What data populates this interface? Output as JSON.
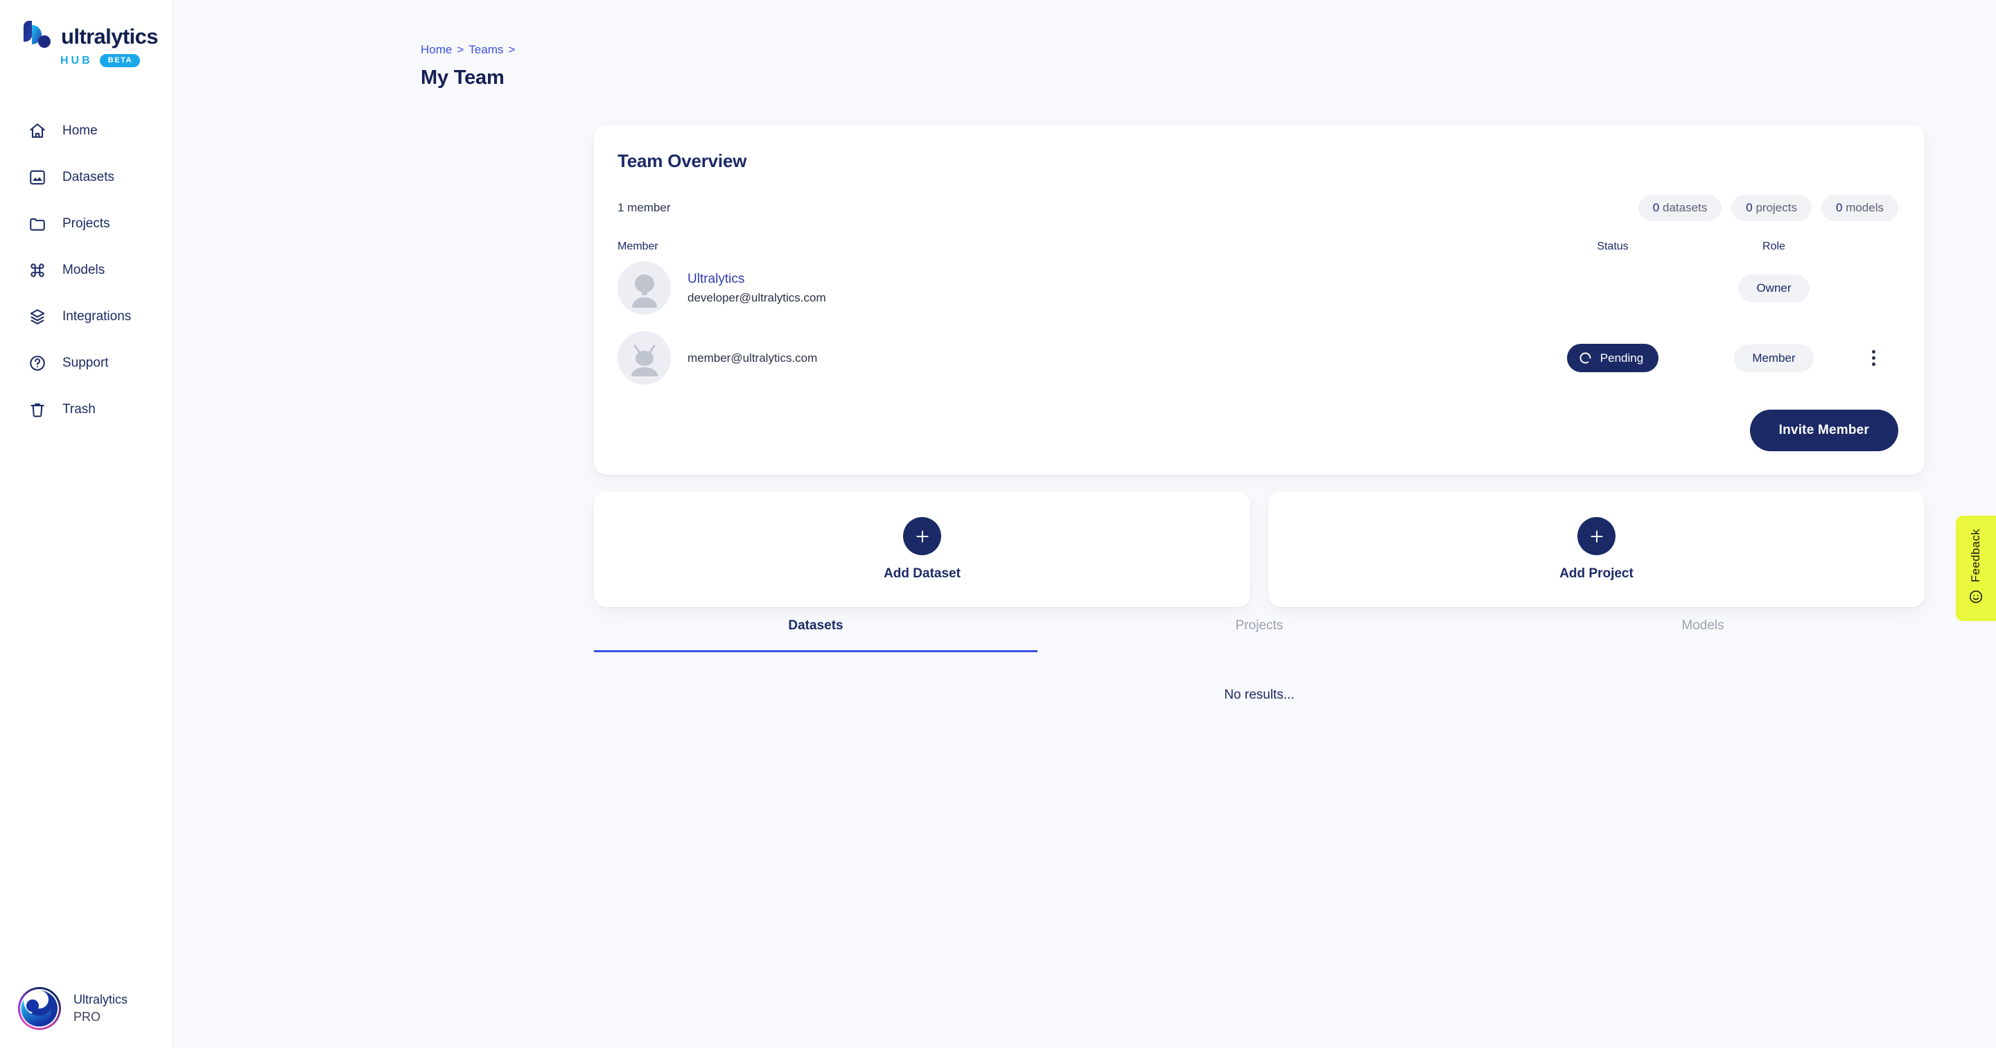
{
  "brand": {
    "word": "ultralytics",
    "hub": "HUB",
    "beta": "BETA"
  },
  "sidebar": {
    "items": [
      {
        "label": "Home",
        "icon": "home-icon"
      },
      {
        "label": "Datasets",
        "icon": "image-icon"
      },
      {
        "label": "Projects",
        "icon": "folder-icon"
      },
      {
        "label": "Models",
        "icon": "command-icon"
      },
      {
        "label": "Integrations",
        "icon": "layers-icon"
      },
      {
        "label": "Support",
        "icon": "question-circle-icon"
      },
      {
        "label": "Trash",
        "icon": "trash-icon"
      }
    ],
    "profile": {
      "name": "Ultralytics",
      "plan": "PRO"
    }
  },
  "breadcrumb": {
    "home": "Home",
    "sep1": ">",
    "teams": "Teams",
    "sep2": ">"
  },
  "page": {
    "title": "My Team"
  },
  "team_overview": {
    "title": "Team Overview",
    "member_count": "1 member",
    "chips": [
      {
        "value": "0",
        "label": "datasets"
      },
      {
        "value": "0",
        "label": "projects"
      },
      {
        "value": "0",
        "label": "models"
      }
    ],
    "columns": {
      "member": "Member",
      "status": "Status",
      "role": "Role"
    },
    "members": [
      {
        "name": "Ultralytics",
        "email": "developer@ultralytics.com",
        "status": "",
        "role": "Owner",
        "has_menu": false
      },
      {
        "name": "",
        "email": "member@ultralytics.com",
        "status": "Pending",
        "role": "Member",
        "has_menu": true
      }
    ],
    "invite_button": "Invite Member"
  },
  "add_cards": [
    {
      "label": "Add Dataset",
      "icon": "plus-icon"
    },
    {
      "label": "Add Project",
      "icon": "plus-icon"
    }
  ],
  "tabs": [
    {
      "label": "Datasets",
      "active": true
    },
    {
      "label": "Projects",
      "active": false
    },
    {
      "label": "Models",
      "active": false
    }
  ],
  "empty_state": "No results...",
  "feedback": {
    "label": "Feedback",
    "icon": "smiley-icon"
  },
  "colors": {
    "navy": "#1b2a66",
    "link_blue": "#3c50e0",
    "cyan": "#1aa8ea",
    "chip_bg": "#f1f2f6",
    "page_bg": "#f8f9fc",
    "feedback_yellow": "#e9f73d"
  }
}
